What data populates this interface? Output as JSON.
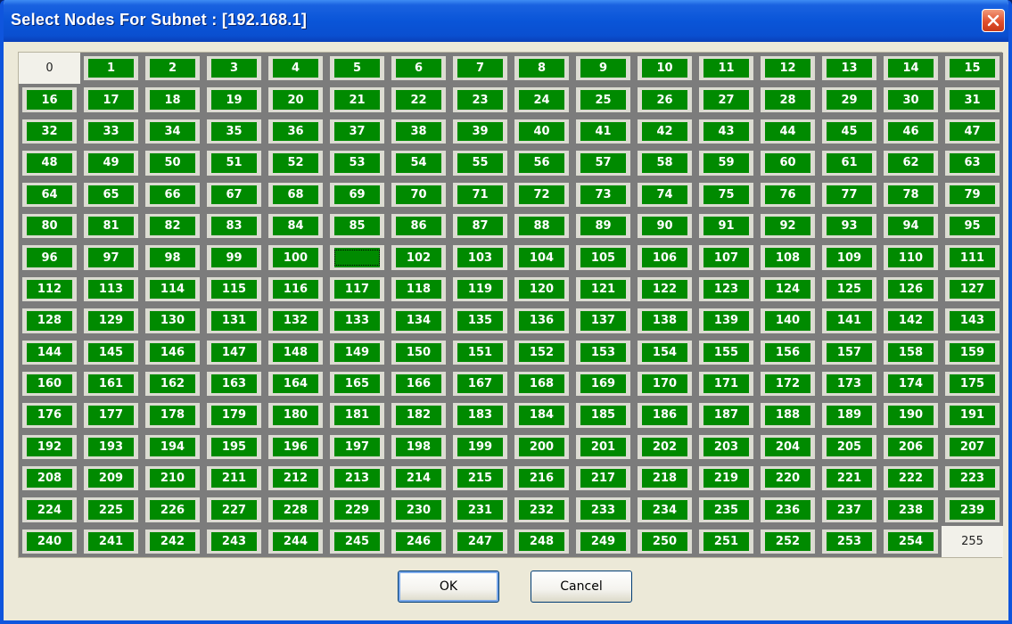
{
  "window": {
    "title": "Select Nodes For Subnet : [192.168.1]"
  },
  "grid": {
    "unselected_nodes": [
      "0",
      "255"
    ],
    "empty_label_nodes": [
      "101"
    ],
    "focused_node": "101"
  },
  "buttons": {
    "ok_label": "OK",
    "cancel_label": "Cancel"
  },
  "colors": {
    "selected_fill": "#008a00",
    "title_bar": "#0a55d8",
    "dialog_bg": "#ece9d8"
  }
}
